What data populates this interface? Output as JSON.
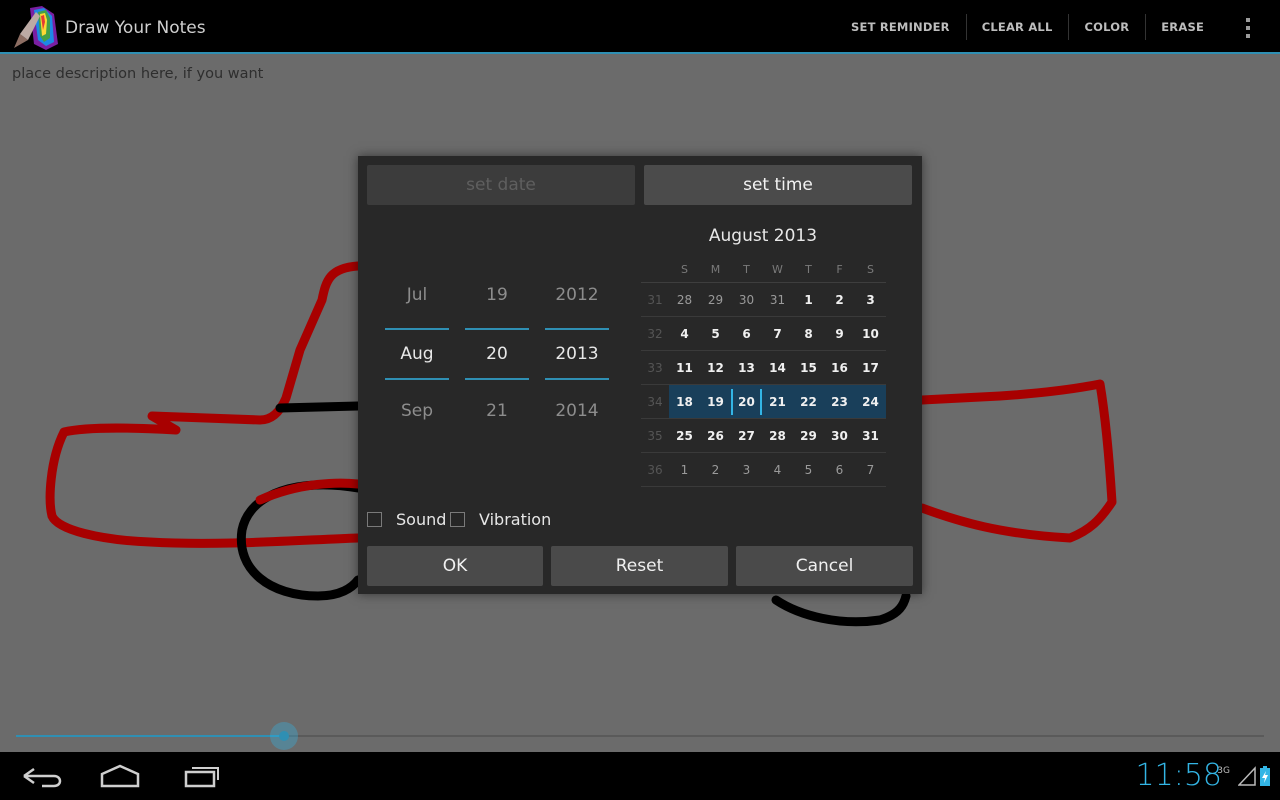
{
  "actionbar": {
    "title": "Draw Your Notes",
    "actions": [
      "SET REMINDER",
      "CLEAR ALL",
      "COLOR",
      "ERASE"
    ]
  },
  "description_placeholder": "place description here, if you want",
  "brush_slider": {
    "value_fraction": 0.215
  },
  "dialog": {
    "tabs": {
      "date": "set date",
      "time": "set time"
    },
    "picker": {
      "month": [
        "Jul",
        "Aug",
        "Sep"
      ],
      "day": [
        "19",
        "20",
        "21"
      ],
      "year": [
        "2012",
        "2013",
        "2014"
      ]
    },
    "calendar": {
      "title": "August 2013",
      "weekdays": [
        "S",
        "M",
        "T",
        "W",
        "T",
        "F",
        "S"
      ],
      "weeks": [
        {
          "num": "31",
          "days": [
            "28",
            "29",
            "30",
            "31",
            "1",
            "2",
            "3"
          ]
        },
        {
          "num": "32",
          "days": [
            "4",
            "5",
            "6",
            "7",
            "8",
            "9",
            "10"
          ]
        },
        {
          "num": "33",
          "days": [
            "11",
            "12",
            "13",
            "14",
            "15",
            "16",
            "17"
          ]
        },
        {
          "num": "34",
          "days": [
            "18",
            "19",
            "20",
            "21",
            "22",
            "23",
            "24"
          ]
        },
        {
          "num": "35",
          "days": [
            "25",
            "26",
            "27",
            "28",
            "29",
            "30",
            "31"
          ]
        },
        {
          "num": "36",
          "days": [
            "1",
            "2",
            "3",
            "4",
            "5",
            "6",
            "7"
          ]
        }
      ]
    },
    "options": {
      "sound": "Sound",
      "vibration": "Vibration"
    },
    "buttons": {
      "ok": "OK",
      "reset": "Reset",
      "cancel": "Cancel"
    }
  },
  "statusbar": {
    "time": "11:58",
    "network": "3G"
  },
  "colors": {
    "accent": "#33b5e5",
    "stroke_red": "#a80000",
    "stroke_black": "#000000"
  }
}
